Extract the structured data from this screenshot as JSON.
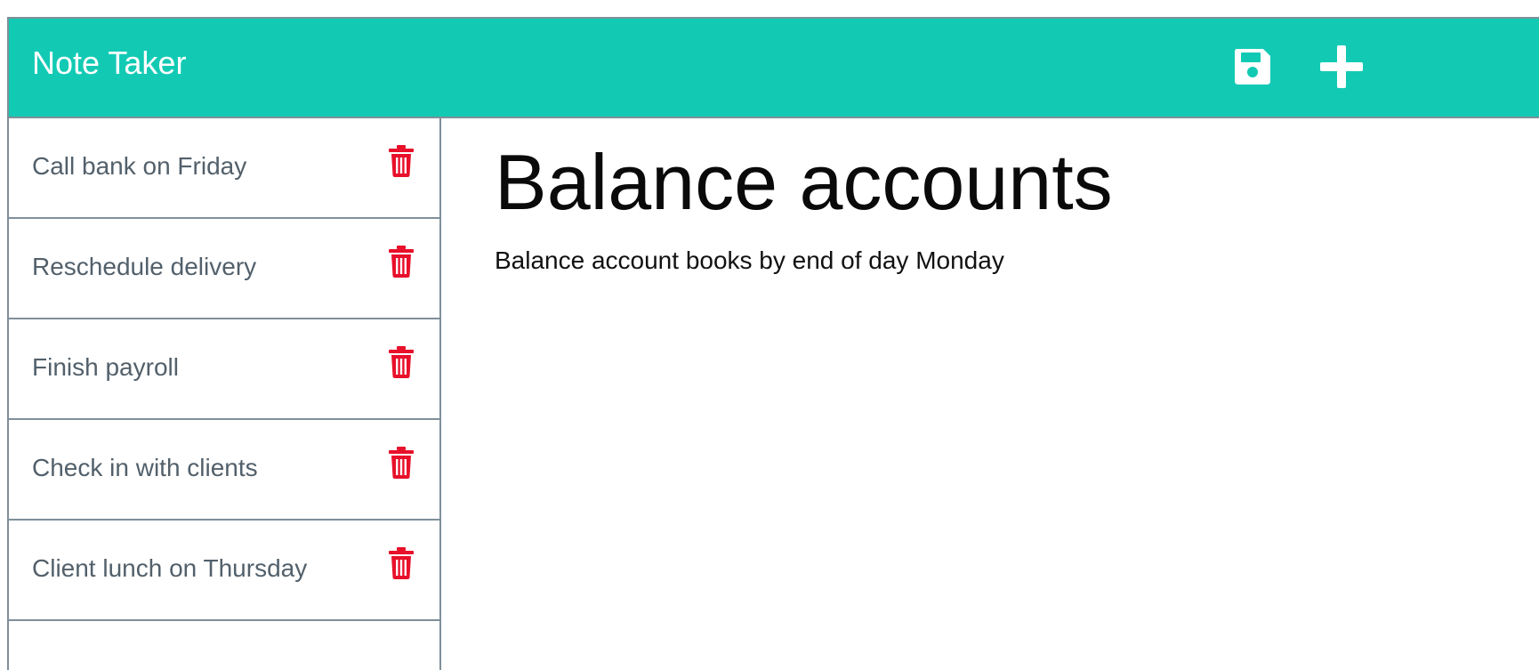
{
  "app": {
    "title": "Note Taker"
  },
  "navbar": {
    "actions": [
      {
        "icon": "save-icon"
      },
      {
        "icon": "plus-icon"
      }
    ]
  },
  "sidebar": {
    "notes": [
      {
        "title": "Call bank on Friday",
        "delete_icon": "trash-icon"
      },
      {
        "title": "Reschedule delivery",
        "delete_icon": "trash-icon"
      },
      {
        "title": "Finish payroll",
        "delete_icon": "trash-icon"
      },
      {
        "title": "Check in with clients",
        "delete_icon": "trash-icon"
      },
      {
        "title": "Client lunch on Thursday",
        "delete_icon": "trash-icon"
      }
    ]
  },
  "active_note": {
    "title": "Balance accounts",
    "text": "Balance account books by end of day Monday"
  },
  "colors": {
    "navbar": "#12cab4",
    "border": "#7f8f99",
    "note_title": "#52606b",
    "delete": "#e8102a"
  }
}
